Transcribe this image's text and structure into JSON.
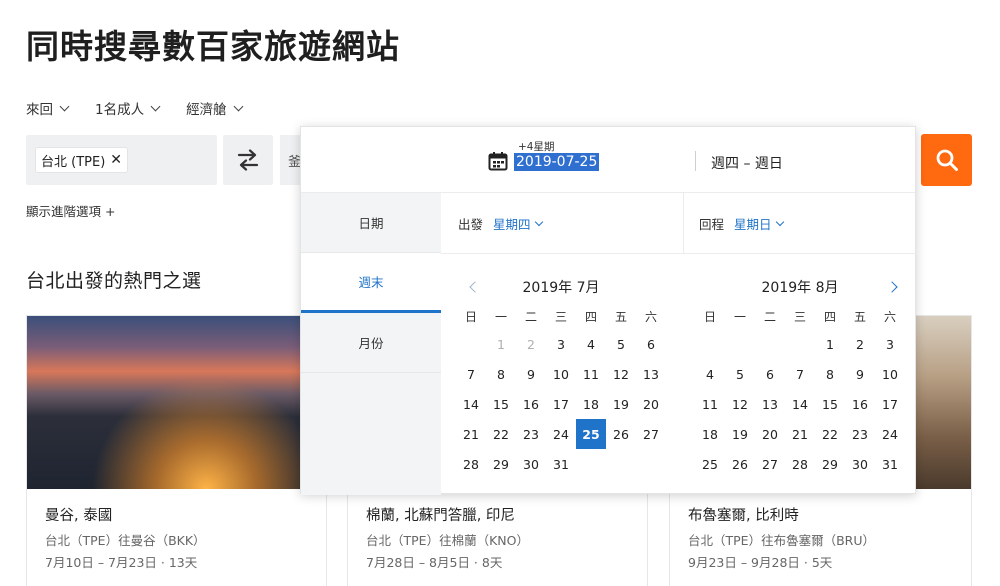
{
  "page": {
    "headline": "同時搜尋數百家旅遊網站"
  },
  "options": {
    "trip_type": "來回",
    "travelers": "1名成人",
    "cabin": "經濟艙"
  },
  "search": {
    "origin_chip": "台北 (TPE)",
    "origin_chip_remove": "✕",
    "destination_partial": "釜",
    "advanced_label": "顯示進階選項 +"
  },
  "section": {
    "title": "台北出發的熱門之選"
  },
  "cards": [
    {
      "title": "曼谷, 泰國",
      "route": "台北（TPE）往曼谷（BKK）",
      "dates": "7月10日 – 7月23日 · 13天"
    },
    {
      "title": "棉蘭, 北蘇門答臘, 印尼",
      "route": "台北（TPE）往棉蘭（KNO）",
      "dates": "7月28日 – 8月5日 · 8天"
    },
    {
      "title": "布魯塞爾, 比利時",
      "route": "台北（TPE）往布魯塞爾（BRU）",
      "dates": "9月23日 – 9月28日 · 5天"
    }
  ],
  "calendar": {
    "plus_label": "+4星期",
    "date_value": "2019-07-25",
    "day_range": "週四 – 週日",
    "tabs": [
      "日期",
      "週末",
      "月份"
    ],
    "active_tab": 1,
    "depart_label": "出發",
    "depart_value": "星期四",
    "return_label": "回程",
    "return_value": "星期日",
    "weekdays": [
      "日",
      "一",
      "二",
      "三",
      "四",
      "五",
      "六"
    ],
    "months": [
      {
        "title": "2019年 7月",
        "first_weekday": 1,
        "days": 31,
        "dim_through": 2,
        "selected": 25
      },
      {
        "title": "2019年 8月",
        "first_weekday": 4,
        "days": 31,
        "dim_through": 0,
        "selected": null
      }
    ]
  },
  "colors": {
    "accent": "#1f73c8",
    "search_button": "#ff690f",
    "selected_text": "#2f6fd0"
  },
  "icons": {
    "swap": "swap-arrows-icon",
    "search": "search-icon",
    "calendar": "calendar-icon"
  }
}
